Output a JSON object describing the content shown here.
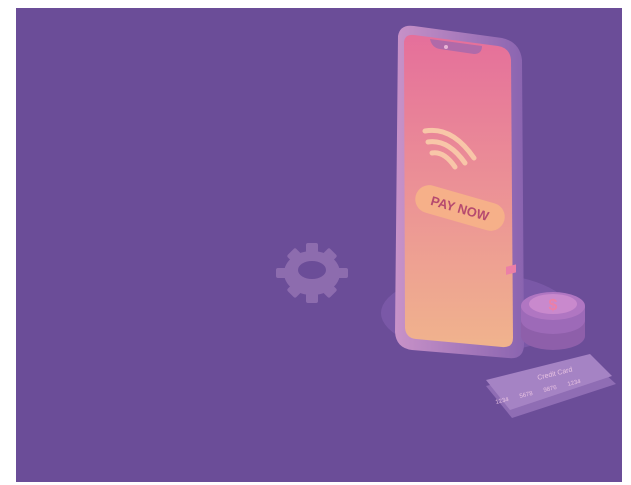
{
  "illustration": {
    "button_label": "PAY NOW",
    "card_title": "Credit Card",
    "card_numbers": [
      "1234",
      "5678",
      "9876",
      "1234"
    ],
    "coin_symbol": "$",
    "colors": {
      "background": "#6b4d98",
      "screen_top": "#e7739b",
      "screen_bottom": "#f0b08d",
      "button": "#f6b089",
      "button_text": "#b64a6f",
      "wifi": "#f8c6a8",
      "phone_body": "#a77ac0",
      "coin": "#b076c2",
      "card": "#a583c4"
    },
    "icons": [
      "gear-icon",
      "contactless-icon",
      "coin-icon",
      "card-chip-icon"
    ]
  }
}
